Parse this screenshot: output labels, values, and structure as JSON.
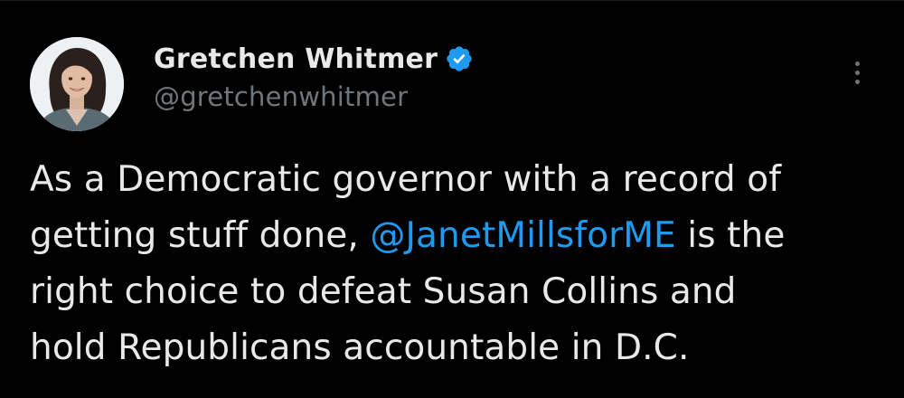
{
  "tweet": {
    "author": {
      "display_name": "Gretchen Whitmer",
      "handle": "@gretchenwhitmer",
      "verified": true,
      "verified_color": "#1d9bf0",
      "avatar_icon": "profile-photo"
    },
    "more_icon": "vertical-ellipsis-icon",
    "text": {
      "line1": "As a Democratic governor with a record of",
      "line2_before": "getting stuff done, ",
      "mention": "@JanetMillsforME",
      "line2_after": " is the",
      "line3": "right choice to defeat Susan Collins and",
      "line4": "hold Republicans accountable in D.C."
    }
  },
  "colors": {
    "background": "#000000",
    "text": "#e7e9ea",
    "secondary_text": "#71767b",
    "link": "#1d9bf0"
  }
}
